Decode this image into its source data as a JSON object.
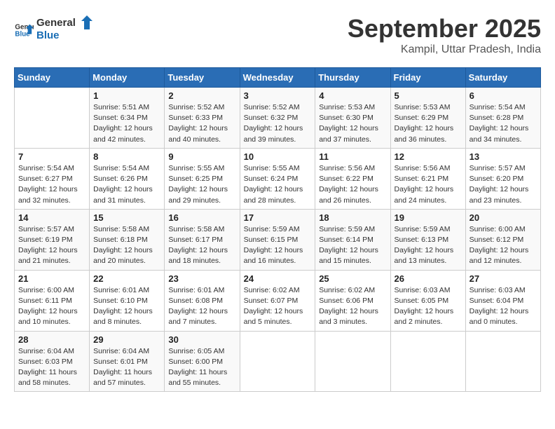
{
  "logo": {
    "general": "General",
    "blue": "Blue"
  },
  "header": {
    "month": "September 2025",
    "location": "Kampil, Uttar Pradesh, India"
  },
  "days_of_week": [
    "Sunday",
    "Monday",
    "Tuesday",
    "Wednesday",
    "Thursday",
    "Friday",
    "Saturday"
  ],
  "weeks": [
    [
      {
        "num": "",
        "info": ""
      },
      {
        "num": "1",
        "info": "Sunrise: 5:51 AM\nSunset: 6:34 PM\nDaylight: 12 hours\nand 42 minutes."
      },
      {
        "num": "2",
        "info": "Sunrise: 5:52 AM\nSunset: 6:33 PM\nDaylight: 12 hours\nand 40 minutes."
      },
      {
        "num": "3",
        "info": "Sunrise: 5:52 AM\nSunset: 6:32 PM\nDaylight: 12 hours\nand 39 minutes."
      },
      {
        "num": "4",
        "info": "Sunrise: 5:53 AM\nSunset: 6:30 PM\nDaylight: 12 hours\nand 37 minutes."
      },
      {
        "num": "5",
        "info": "Sunrise: 5:53 AM\nSunset: 6:29 PM\nDaylight: 12 hours\nand 36 minutes."
      },
      {
        "num": "6",
        "info": "Sunrise: 5:54 AM\nSunset: 6:28 PM\nDaylight: 12 hours\nand 34 minutes."
      }
    ],
    [
      {
        "num": "7",
        "info": "Sunrise: 5:54 AM\nSunset: 6:27 PM\nDaylight: 12 hours\nand 32 minutes."
      },
      {
        "num": "8",
        "info": "Sunrise: 5:54 AM\nSunset: 6:26 PM\nDaylight: 12 hours\nand 31 minutes."
      },
      {
        "num": "9",
        "info": "Sunrise: 5:55 AM\nSunset: 6:25 PM\nDaylight: 12 hours\nand 29 minutes."
      },
      {
        "num": "10",
        "info": "Sunrise: 5:55 AM\nSunset: 6:24 PM\nDaylight: 12 hours\nand 28 minutes."
      },
      {
        "num": "11",
        "info": "Sunrise: 5:56 AM\nSunset: 6:22 PM\nDaylight: 12 hours\nand 26 minutes."
      },
      {
        "num": "12",
        "info": "Sunrise: 5:56 AM\nSunset: 6:21 PM\nDaylight: 12 hours\nand 24 minutes."
      },
      {
        "num": "13",
        "info": "Sunrise: 5:57 AM\nSunset: 6:20 PM\nDaylight: 12 hours\nand 23 minutes."
      }
    ],
    [
      {
        "num": "14",
        "info": "Sunrise: 5:57 AM\nSunset: 6:19 PM\nDaylight: 12 hours\nand 21 minutes."
      },
      {
        "num": "15",
        "info": "Sunrise: 5:58 AM\nSunset: 6:18 PM\nDaylight: 12 hours\nand 20 minutes."
      },
      {
        "num": "16",
        "info": "Sunrise: 5:58 AM\nSunset: 6:17 PM\nDaylight: 12 hours\nand 18 minutes."
      },
      {
        "num": "17",
        "info": "Sunrise: 5:59 AM\nSunset: 6:15 PM\nDaylight: 12 hours\nand 16 minutes."
      },
      {
        "num": "18",
        "info": "Sunrise: 5:59 AM\nSunset: 6:14 PM\nDaylight: 12 hours\nand 15 minutes."
      },
      {
        "num": "19",
        "info": "Sunrise: 5:59 AM\nSunset: 6:13 PM\nDaylight: 12 hours\nand 13 minutes."
      },
      {
        "num": "20",
        "info": "Sunrise: 6:00 AM\nSunset: 6:12 PM\nDaylight: 12 hours\nand 12 minutes."
      }
    ],
    [
      {
        "num": "21",
        "info": "Sunrise: 6:00 AM\nSunset: 6:11 PM\nDaylight: 12 hours\nand 10 minutes."
      },
      {
        "num": "22",
        "info": "Sunrise: 6:01 AM\nSunset: 6:10 PM\nDaylight: 12 hours\nand 8 minutes."
      },
      {
        "num": "23",
        "info": "Sunrise: 6:01 AM\nSunset: 6:08 PM\nDaylight: 12 hours\nand 7 minutes."
      },
      {
        "num": "24",
        "info": "Sunrise: 6:02 AM\nSunset: 6:07 PM\nDaylight: 12 hours\nand 5 minutes."
      },
      {
        "num": "25",
        "info": "Sunrise: 6:02 AM\nSunset: 6:06 PM\nDaylight: 12 hours\nand 3 minutes."
      },
      {
        "num": "26",
        "info": "Sunrise: 6:03 AM\nSunset: 6:05 PM\nDaylight: 12 hours\nand 2 minutes."
      },
      {
        "num": "27",
        "info": "Sunrise: 6:03 AM\nSunset: 6:04 PM\nDaylight: 12 hours\nand 0 minutes."
      }
    ],
    [
      {
        "num": "28",
        "info": "Sunrise: 6:04 AM\nSunset: 6:03 PM\nDaylight: 11 hours\nand 58 minutes."
      },
      {
        "num": "29",
        "info": "Sunrise: 6:04 AM\nSunset: 6:01 PM\nDaylight: 11 hours\nand 57 minutes."
      },
      {
        "num": "30",
        "info": "Sunrise: 6:05 AM\nSunset: 6:00 PM\nDaylight: 11 hours\nand 55 minutes."
      },
      {
        "num": "",
        "info": ""
      },
      {
        "num": "",
        "info": ""
      },
      {
        "num": "",
        "info": ""
      },
      {
        "num": "",
        "info": ""
      }
    ]
  ]
}
